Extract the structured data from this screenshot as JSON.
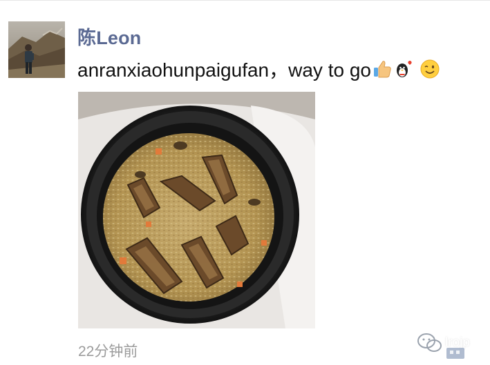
{
  "post": {
    "username": "陈Leon",
    "text": "anranxiaohunpaigufan，way to go",
    "emojis": [
      "thumbs-up",
      "penguin-heart",
      "winking-face"
    ],
    "timestamp": "22分钟前"
  },
  "watermark": {
    "text": "lrojp",
    "icon": "wechat-logo-icon"
  },
  "colors": {
    "username": "#5b6a93",
    "timestamp": "#9b9b9b",
    "text": "#111111"
  }
}
